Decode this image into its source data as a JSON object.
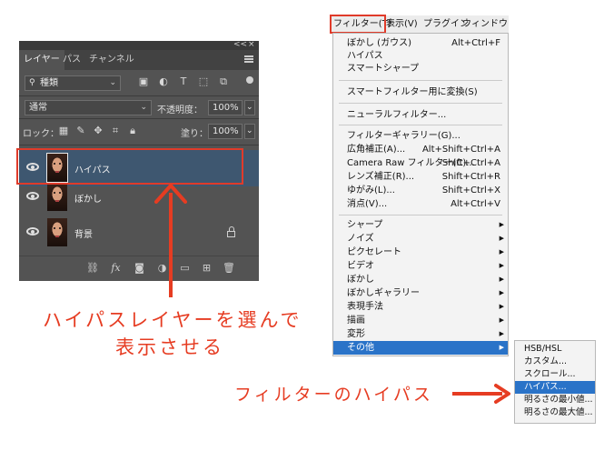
{
  "layers_panel": {
    "window_controls": [
      "<<",
      "×"
    ],
    "tabs": [
      "レイヤー",
      "パス",
      "チャンネル"
    ],
    "filter_kind": "種類",
    "blend_mode": "通常",
    "opacity_label": "不透明度：",
    "opacity_value": "100%",
    "lock_label": "ロック：",
    "fill_label": "塗り：",
    "fill_value": "100%",
    "layers": [
      {
        "name": "ハイパス",
        "selected": true
      },
      {
        "name": "ぼかし",
        "selected": false
      },
      {
        "name": "背景",
        "selected": false,
        "locked": true
      }
    ],
    "bottom_fx": "fx"
  },
  "menubar": {
    "items": [
      "フィルター(T)",
      "表示(V)",
      "プラグイン",
      "ウィンドウ(W)"
    ]
  },
  "filter_menu": {
    "groups": [
      [
        {
          "label": "ぼかし (ガウス)",
          "shortcut": "Alt+Ctrl+F"
        },
        {
          "label": "ハイパス",
          "shortcut": ""
        },
        {
          "label": "スマートシャープ",
          "shortcut": ""
        }
      ],
      [
        {
          "label": "スマートフィルター用に変換(S)",
          "shortcut": ""
        }
      ],
      [
        {
          "label": "ニューラルフィルター...",
          "shortcut": ""
        }
      ],
      [
        {
          "label": "フィルターギャラリー(G)...",
          "shortcut": ""
        },
        {
          "label": "広角補正(A)...",
          "shortcut": "Alt+Shift+Ctrl+A"
        },
        {
          "label": "Camera Raw フィルター(C)...",
          "shortcut": "Shift+Ctrl+A"
        },
        {
          "label": "レンズ補正(R)...",
          "shortcut": "Shift+Ctrl+R"
        },
        {
          "label": "ゆがみ(L)...",
          "shortcut": "Shift+Ctrl+X"
        },
        {
          "label": "消点(V)...",
          "shortcut": "Alt+Ctrl+V"
        }
      ],
      [
        {
          "label": "シャープ",
          "submenu": true
        },
        {
          "label": "ノイズ",
          "submenu": true
        },
        {
          "label": "ピクセレート",
          "submenu": true
        },
        {
          "label": "ビデオ",
          "submenu": true
        },
        {
          "label": "ぼかし",
          "submenu": true
        },
        {
          "label": "ぼかしギャラリー",
          "submenu": true
        },
        {
          "label": "表現手法",
          "submenu": true
        },
        {
          "label": "描画",
          "submenu": true
        },
        {
          "label": "変形",
          "submenu": true
        },
        {
          "label": "その他",
          "submenu": true,
          "selected": true
        }
      ]
    ]
  },
  "other_submenu": {
    "items": [
      "HSB/HSL",
      "カスタム...",
      "スクロール...",
      "ハイパス...",
      "明るさの最小値...",
      "明るさの最大値..."
    ],
    "selected_index": 3
  },
  "annotations": {
    "left_line1": "ハイパスレイヤーを選んで",
    "left_line2": "表示させる",
    "right": "フィルターのハイパス"
  },
  "colors": {
    "annotation_red": "#e63c22",
    "menu_highlight": "#2a73c8",
    "panel_bg": "#535353",
    "selected_layer": "#3e5770"
  }
}
